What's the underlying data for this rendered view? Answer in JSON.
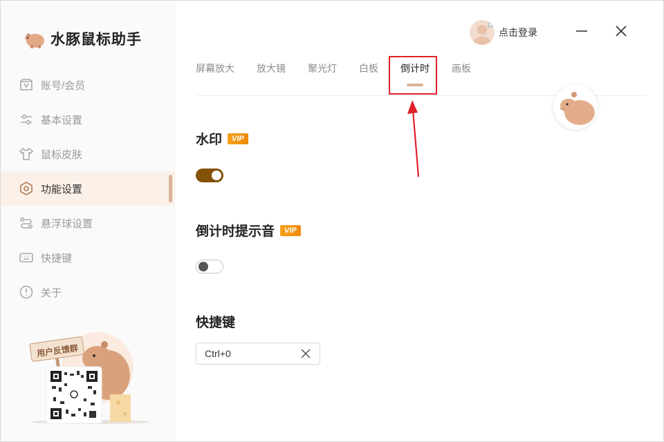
{
  "app": {
    "name": "水豚鼠标助手"
  },
  "user": {
    "login_label": "点击登录"
  },
  "sidebar": {
    "items": [
      {
        "label": "账号/会员",
        "icon": "member-icon"
      },
      {
        "label": "基本设置",
        "icon": "sliders-icon"
      },
      {
        "label": "鼠标皮肤",
        "icon": "shirt-icon"
      },
      {
        "label": "功能设置",
        "icon": "hexagon-icon",
        "active": true
      },
      {
        "label": "悬浮球设置",
        "icon": "float-ball-icon"
      },
      {
        "label": "快捷键",
        "icon": "keyboard-icon"
      },
      {
        "label": "关于",
        "icon": "info-icon"
      }
    ],
    "feedback_label": "用户反馈群"
  },
  "tabs": [
    {
      "label": "屏幕放大"
    },
    {
      "label": "放大镜"
    },
    {
      "label": "聚光灯"
    },
    {
      "label": "白板"
    },
    {
      "label": "倒计时",
      "active": true
    },
    {
      "label": "画板"
    }
  ],
  "sections": {
    "watermark": {
      "title": "水印",
      "badge": "VIP",
      "enabled": true
    },
    "countdown_sound": {
      "title": "倒计时提示音",
      "badge": "VIP",
      "enabled": false
    },
    "shortcut": {
      "title": "快捷键",
      "value": "Ctrl+0"
    }
  },
  "colors": {
    "accent": "#d9b296",
    "toggle_on": "#835108",
    "vip": "#f7a21b",
    "highlight": "#e0202a"
  }
}
